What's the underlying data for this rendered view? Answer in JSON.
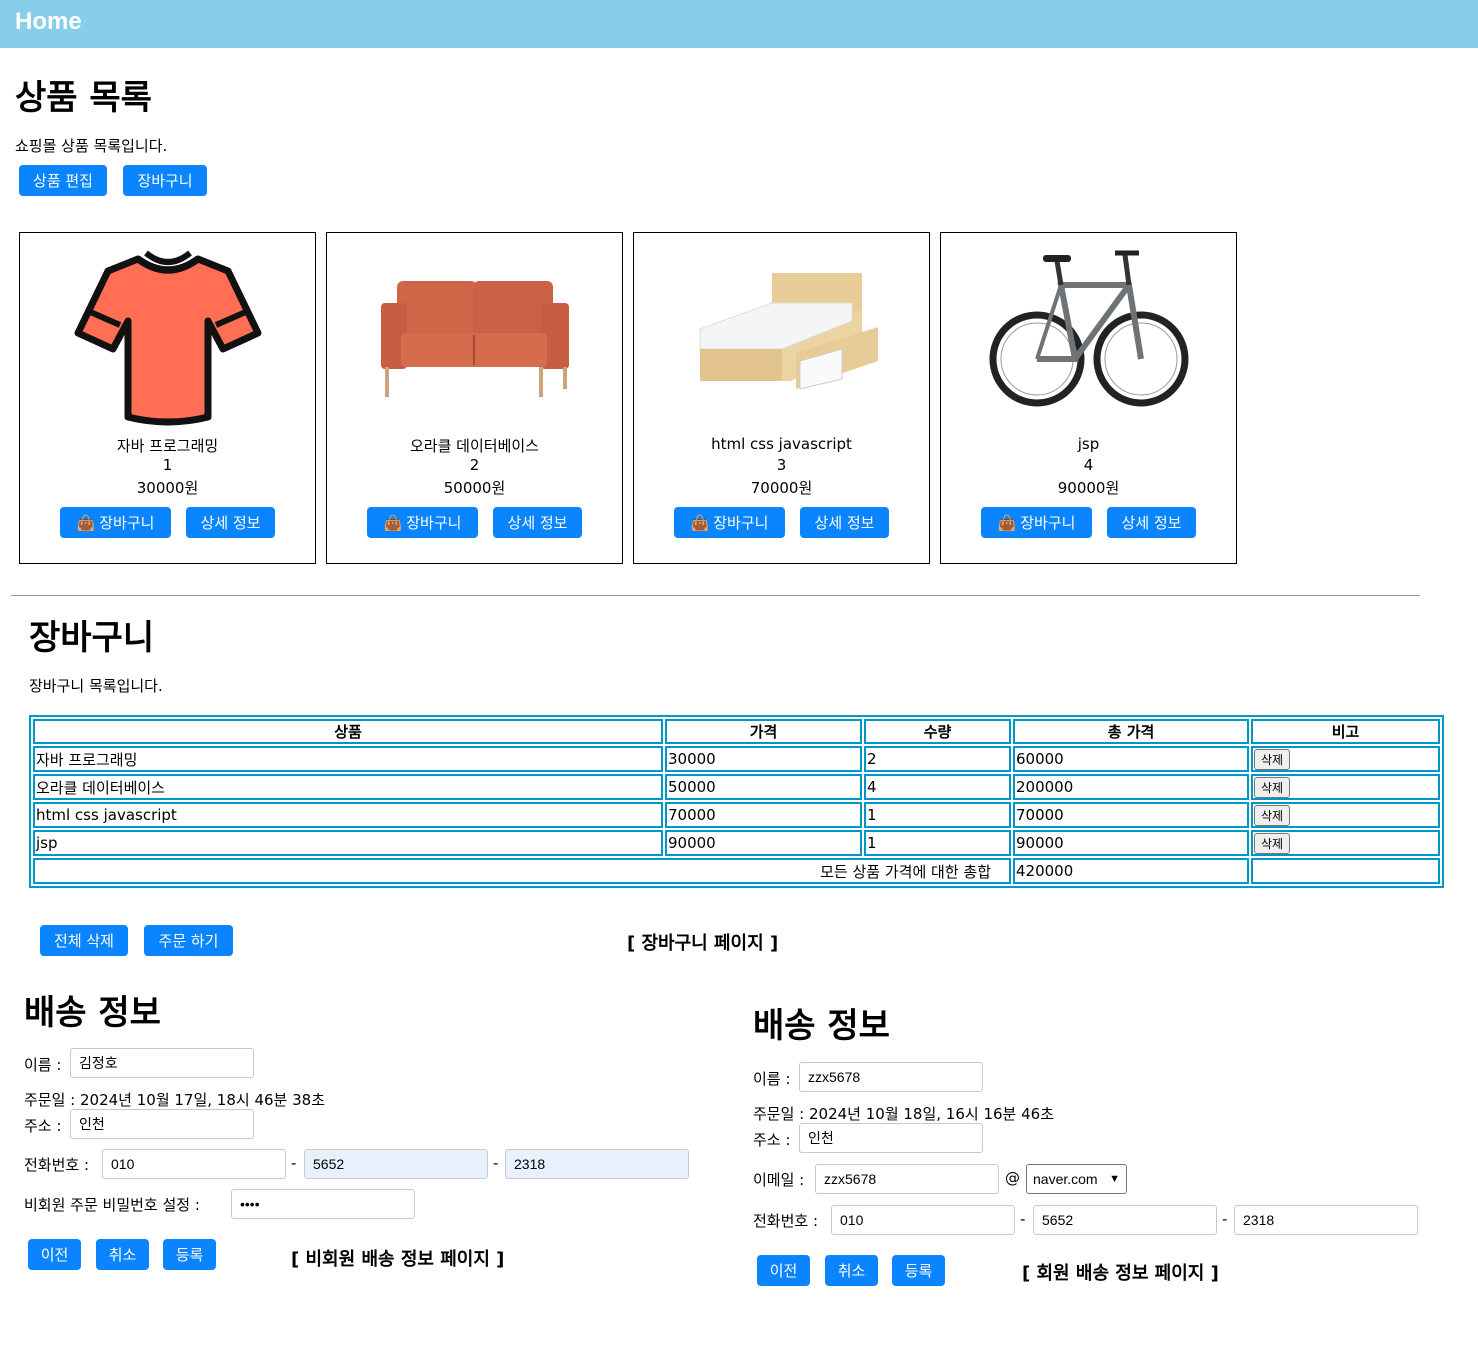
{
  "topbar": {
    "title": "Home"
  },
  "products_section": {
    "title": "상품 목록",
    "subtitle": "쇼핑몰 상품 목록입니다.",
    "edit_button": "상품 편집",
    "cart_button": "장바구니"
  },
  "products": [
    {
      "name": "자바 프로그래밍",
      "id": "1",
      "price": "30000원",
      "cart_label": "장바구니",
      "detail_label": "상세 정보",
      "image": "tshirt"
    },
    {
      "name": "오라클 데이터베이스",
      "id": "2",
      "price": "50000원",
      "cart_label": "장바구니",
      "detail_label": "상세 정보",
      "image": "sofa"
    },
    {
      "name": "html css javascript",
      "id": "3",
      "price": "70000원",
      "cart_label": "장바구니",
      "detail_label": "상세 정보",
      "image": "bed"
    },
    {
      "name": "jsp",
      "id": "4",
      "price": "90000원",
      "cart_label": "장바구니",
      "detail_label": "상세 정보",
      "image": "bicycle"
    }
  ],
  "cart": {
    "title": "장바구니",
    "subtitle": "장바구니 목록입니다.",
    "headers": [
      "상품",
      "가격",
      "수량",
      "총 가격",
      "비고"
    ],
    "rows": [
      {
        "product": "자바 프로그래밍",
        "price": "30000",
        "qty": "2",
        "total": "60000",
        "action": "삭제"
      },
      {
        "product": "오라클 데이터베이스",
        "price": "50000",
        "qty": "4",
        "total": "200000",
        "action": "삭제"
      },
      {
        "product": "html css javascript",
        "price": "70000",
        "qty": "1",
        "total": "70000",
        "action": "삭제"
      },
      {
        "product": "jsp",
        "price": "90000",
        "qty": "1",
        "total": "90000",
        "action": "삭제"
      }
    ],
    "sum_label": "모든 상품 가격에 대한 총합",
    "sum_value": "420000",
    "delete_all_button": "전체 삭제",
    "order_button": "주문 하기",
    "page_caption": "[ 장바구니 페이지 ]"
  },
  "guest_shipping": {
    "title": "배송 정보",
    "name_label": "이름 :",
    "name_value": "김정호",
    "order_date": "주문일 : 2024년 10월 17일, 18시 46분 38초",
    "address_label": "주소 :",
    "address_value": "인천",
    "phone_label": "전화번호 :",
    "phone1": "010",
    "phone2": "5652",
    "phone3": "2318",
    "dash": "-",
    "password_label": "비회원 주문 비밀번호 설정 :",
    "password_value": "••••",
    "prev_button": "이전",
    "cancel_button": "취소",
    "register_button": "등록",
    "page_caption": "[ 비회원 배송 정보 페이지 ]"
  },
  "member_shipping": {
    "title": "배송 정보",
    "name_label": "이름 :",
    "name_value": "zzx5678",
    "order_date": "주문일 : 2024년 10월 18일, 16시 16분 46초",
    "address_label": "주소 :",
    "address_value": "인천",
    "email_label": "이메일 :",
    "email_id": "zzx5678",
    "at": "@",
    "email_domain": "naver.com",
    "phone_label": "전화번호 :",
    "phone1": "010",
    "phone2": "5652",
    "phone3": "2318",
    "dash": "-",
    "prev_button": "이전",
    "cancel_button": "취소",
    "register_button": "등록",
    "page_caption": "[ 회원 배송 정보 페이지 ]"
  },
  "colors": {
    "topbar": "#87ceeb",
    "button": "#0a84ff",
    "table_border": "#0096c7"
  }
}
